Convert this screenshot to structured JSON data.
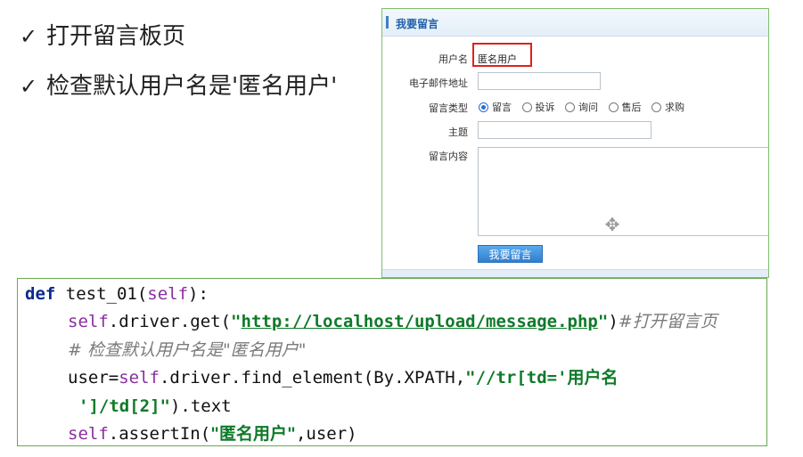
{
  "bullets": [
    {
      "check": "✓",
      "text": "打开留言板页"
    },
    {
      "check": "✓",
      "text": "检查默认用户名是'匿名用户'"
    }
  ],
  "form": {
    "header_title": "我要留言",
    "username_label": "用户名",
    "username_value": "匿名用户",
    "email_label": "电子邮件地址",
    "email_value": "",
    "type_label": "留言类型",
    "type_options": [
      "留言",
      "投诉",
      "询问",
      "售后",
      "求购"
    ],
    "type_selected": "留言",
    "subject_label": "主题",
    "subject_value": "",
    "content_label": "留言内容",
    "content_value": "",
    "submit_label": "我要留言",
    "move_icon": "move-cursor-icon"
  },
  "code": {
    "l1_def": "def",
    "l1_rest": " test_01(",
    "l1_self": "self",
    "l1_end": "):",
    "l2_self": "self",
    "l2_mid": ".driver.get(",
    "l2_q1": "\"",
    "l2_url": "http://localhost/upload/message.php",
    "l2_q2": "\"",
    "l2_close": ")",
    "l2_comment": "#打开留言页",
    "l3_comment": "#  检查默认用户名是\"匿名用户\"",
    "l4_user": "user",
    "l4_eq": "=",
    "l4_self": "self",
    "l4_mid": ".driver.find_element(By.XPATH,",
    "l4_str1": "\"//tr[td='",
    "l4_cjk": "用户名",
    "l5_str": "']/td[2]\"",
    "l5_rest": ").text",
    "l6_self": "self",
    "l6_mid": ".assertIn(",
    "l6_str": "\"匿名用户\"",
    "l6_end": ",user)"
  }
}
